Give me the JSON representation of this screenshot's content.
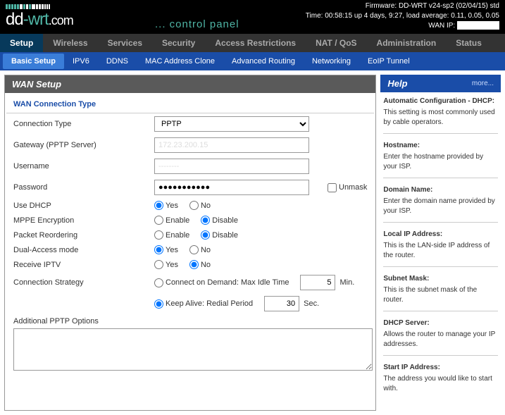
{
  "header": {
    "logo_dd": "dd",
    "logo_wrt": "-wrt",
    "logo_domain": ".com",
    "tagline": "... control panel",
    "firmware": "Firmware: DD-WRT v24-sp2 (02/04/15) std",
    "time": "Time: 00:58:15 up 4 days, 9:27, load average: 0.11, 0.05, 0.05",
    "wanip_label": "WAN IP:"
  },
  "tabs": [
    "Setup",
    "Wireless",
    "Services",
    "Security",
    "Access Restrictions",
    "NAT / QoS",
    "Administration",
    "Status"
  ],
  "subtabs": [
    "Basic Setup",
    "IPV6",
    "DDNS",
    "MAC Address Clone",
    "Advanced Routing",
    "Networking",
    "EoIP Tunnel"
  ],
  "section": "WAN Setup",
  "fieldset": "WAN Connection Type",
  "labels": {
    "conn_type": "Connection Type",
    "gateway": "Gateway (PPTP Server)",
    "username": "Username",
    "password": "Password",
    "unmask": "Unmask",
    "use_dhcp": "Use DHCP",
    "mppe": "MPPE Encryption",
    "reorder": "Packet Reordering",
    "dual": "Dual-Access mode",
    "iptv": "Receive IPTV",
    "strategy": "Connection Strategy",
    "addl": "Additional PPTP Options",
    "yes": "Yes",
    "no": "No",
    "enable": "Enable",
    "disable": "Disable",
    "connect_demand": "Connect on Demand: Max Idle Time",
    "min": "Min.",
    "keep_alive": "Keep Alive: Redial Period",
    "sec": "Sec."
  },
  "values": {
    "conn_type": "PPTP",
    "gateway": "172.23.200.15",
    "username": "--------",
    "password": "●●●●●●●●●●●",
    "idle": "5",
    "redial": "30"
  },
  "help": {
    "title": "Help",
    "more": "more...",
    "items": [
      {
        "t": "Automatic Configuration - DHCP:",
        "d": "This setting is most commonly used by cable operators."
      },
      {
        "t": "Hostname:",
        "d": "Enter the hostname provided by your ISP."
      },
      {
        "t": "Domain Name:",
        "d": "Enter the domain name provided by your ISP."
      },
      {
        "t": "Local IP Address:",
        "d": "This is the LAN-side IP address of the router."
      },
      {
        "t": "Subnet Mask:",
        "d": "This is the subnet mask of the router."
      },
      {
        "t": "DHCP Server:",
        "d": "Allows the router to manage your IP addresses."
      },
      {
        "t": "Start IP Address:",
        "d": "The address you would like to start with."
      }
    ]
  }
}
